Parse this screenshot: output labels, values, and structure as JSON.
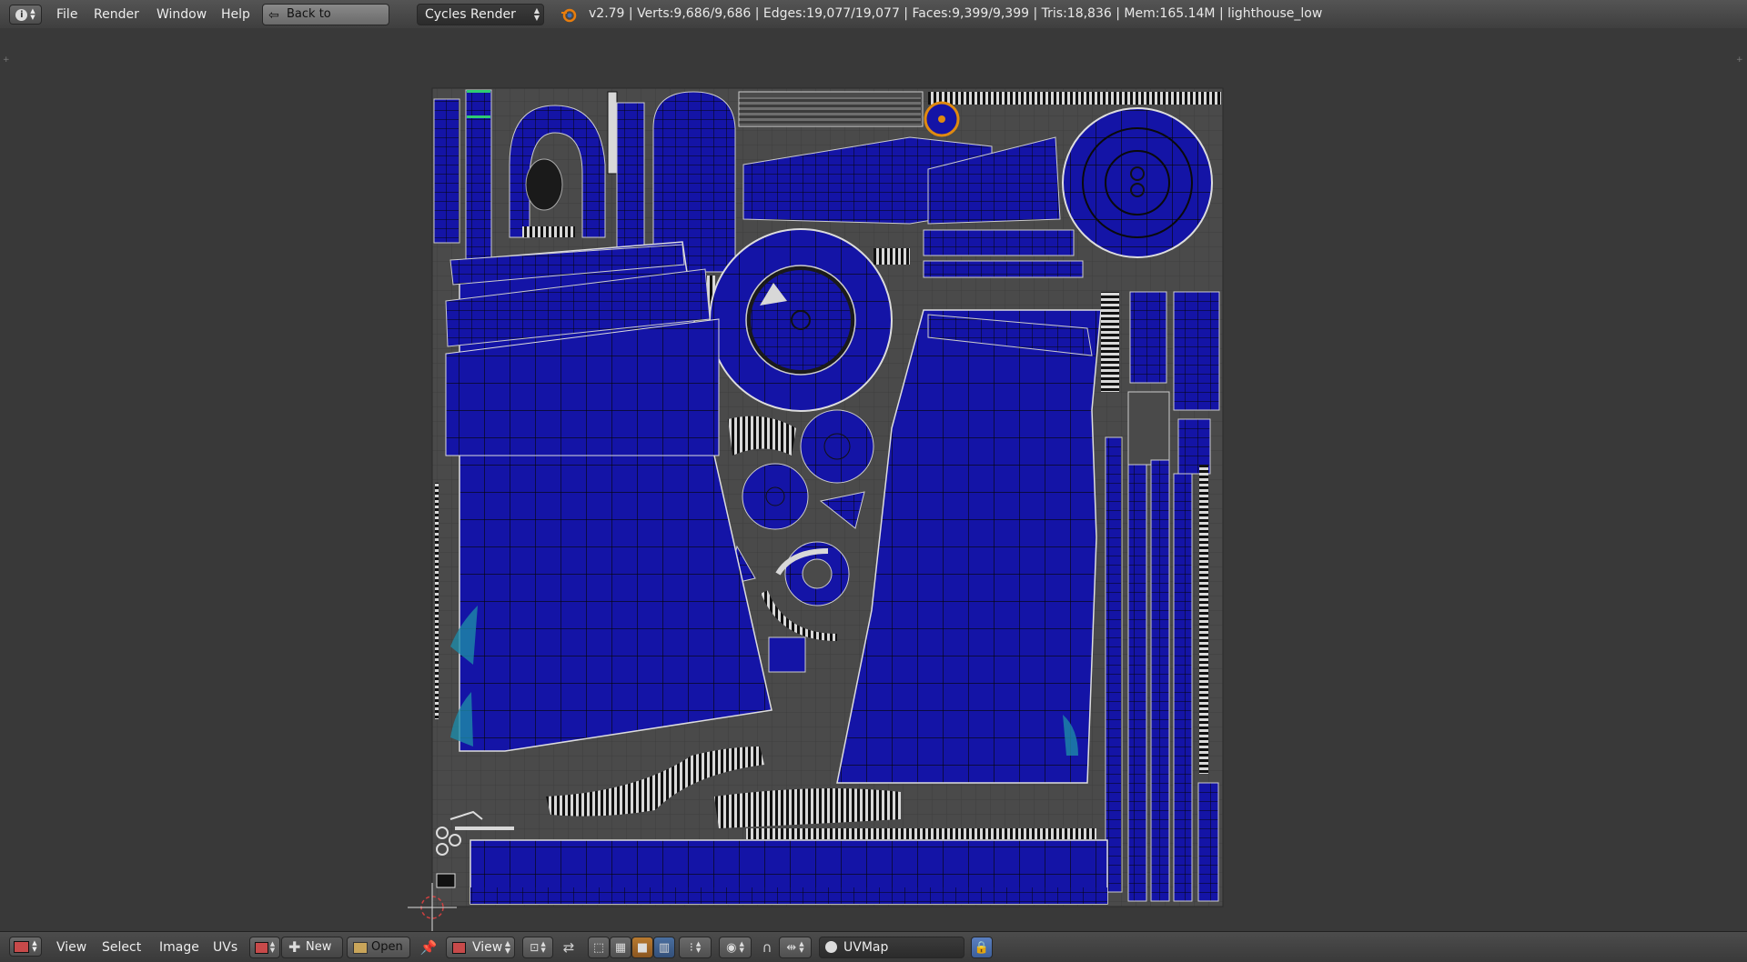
{
  "topbar": {
    "editor_icon": "info-icon",
    "menus": [
      "File",
      "Render",
      "Window",
      "Help"
    ],
    "back_button": "Back to Previous",
    "render_engine": "Cycles Render",
    "stats": "v2.79 | Verts:9,686/9,686 | Edges:19,077/19,077 | Faces:9,399/9,399 | Tris:18,836 | Mem:165.14M | lighthouse_low"
  },
  "bottombar": {
    "editor_icon": "image-editor-icon",
    "menus": [
      "View",
      "Select",
      "Image",
      "UVs"
    ],
    "new_button": "New",
    "open_button": "Open",
    "view_dropdown": "View",
    "uv_map": "UVMap"
  },
  "colors": {
    "uv_face": "#1515a8",
    "uv_edge": "#0a0a0a",
    "uv_outline": "#cfcfcf",
    "grid_bg": "#4a4a4a",
    "cursor": "#d04040",
    "selected_face": "#e08a10"
  }
}
